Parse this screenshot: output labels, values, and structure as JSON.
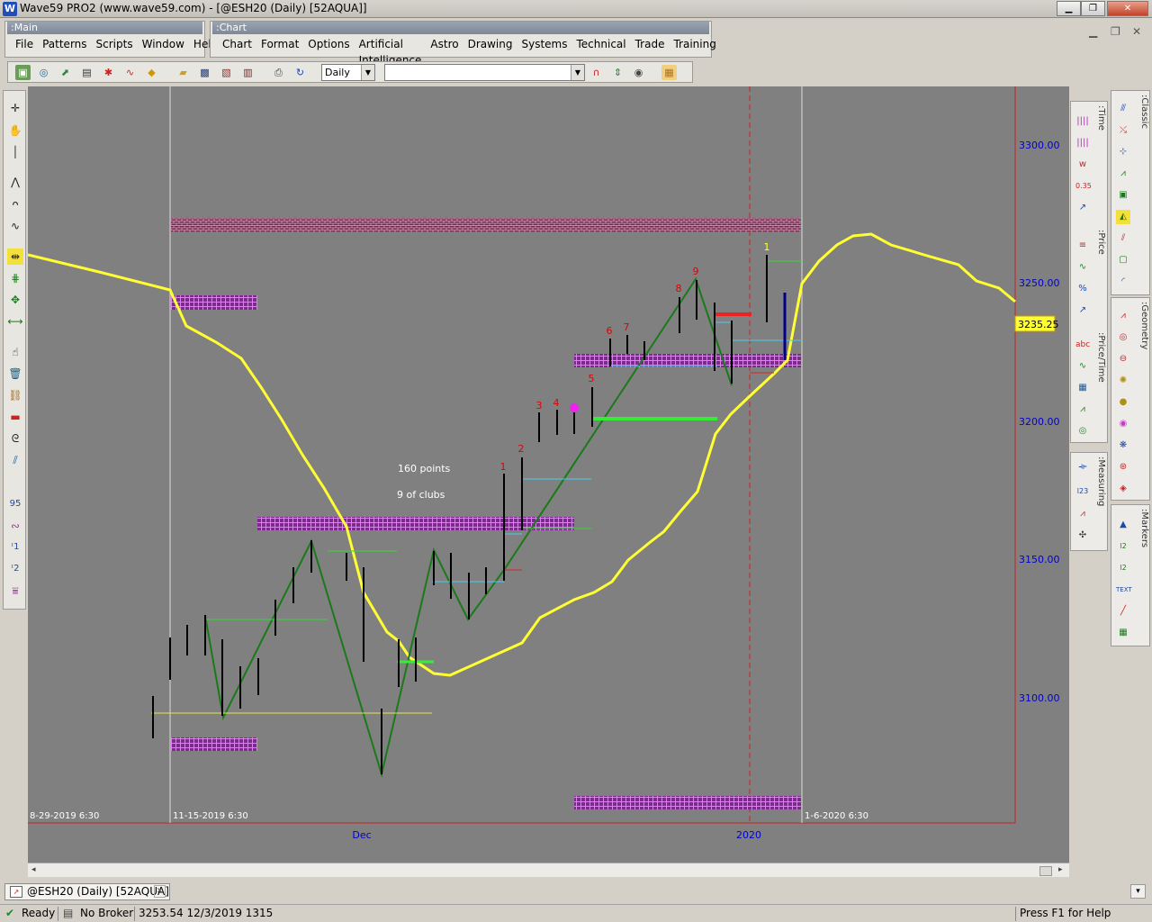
{
  "window": {
    "app_title": "Wave59 PRO2 (www.wave59.com) - [@ESH20 (Daily) [52AQUA]]",
    "app_icon": "W",
    "minimize": "▁",
    "restore": "❐",
    "close": "✕"
  },
  "main_panel": {
    "title": ":Main",
    "menu": [
      "File",
      "Patterns",
      "Scripts",
      "Window",
      "Help"
    ]
  },
  "chart_panel": {
    "title": ":Chart",
    "menu": [
      "Chart",
      "Format",
      "Options",
      "Artificial Intelligence",
      "Astro",
      "Drawing",
      "Systems",
      "Technical",
      "Trade",
      "Training"
    ]
  },
  "toolbar": {
    "interval_value": "Daily",
    "symbol_value": ""
  },
  "right_panels": {
    "time": ":Time",
    "price": ":Price",
    "price_time": ":Price/Time",
    "measuring": ":Measuring",
    "classic": ":Classic",
    "geometry": ":Geometry",
    "markers": ":Markers"
  },
  "chart": {
    "price_labels": [
      "3300.00",
      "3250.00",
      "3200.00",
      "3150.00",
      "3100.00"
    ],
    "current_price": "3235.25",
    "date_labels": {
      "overlap": "8-29-2019 6:30",
      "start": "11-15-2019 6:30",
      "end": "1-6-2020 6:30"
    },
    "month_labels": [
      "Dec",
      "2020"
    ],
    "annotations": [
      "160 points",
      "9 of clubs"
    ],
    "count_labels": [
      "1",
      "2",
      "3",
      "4",
      "5",
      "6",
      "7",
      "8",
      "9"
    ],
    "count_label_top": "1"
  },
  "tabs": {
    "doc_tab": "@ESH20 (Daily) [52AQUA]"
  },
  "status": {
    "ready": "Ready",
    "broker": "No Broker",
    "info": "3253.54  12/3/2019  1315",
    "help": "Press F1 for Help"
  },
  "colors": {
    "chart_bg": "#808080",
    "yellow_line": "#ffff33",
    "wave_line": "#1a7a1a",
    "price_axis": "#0000cc",
    "count_red": "#e00000"
  }
}
